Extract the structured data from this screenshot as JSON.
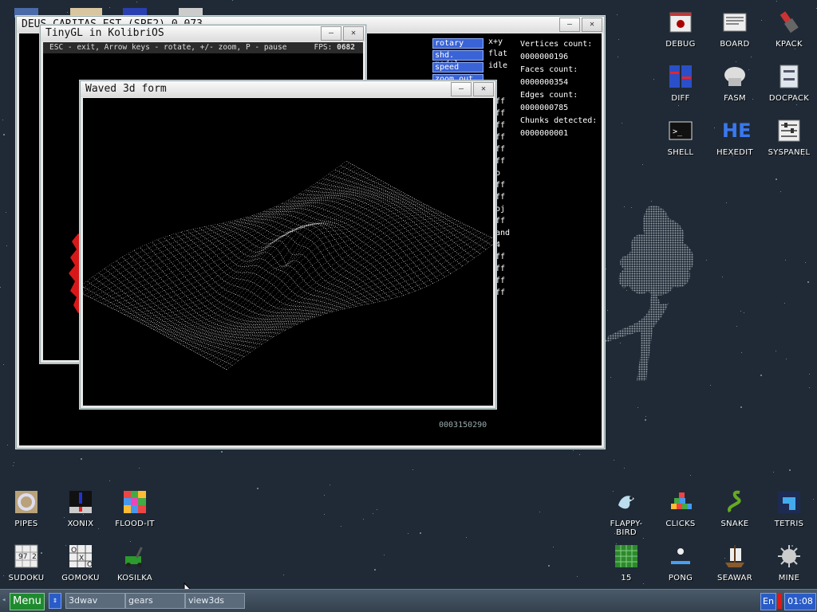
{
  "windows": {
    "deus": {
      "title": "DEUS CARITAS EST (SPF2) 0.073",
      "counter": "0003150290"
    },
    "tinygl": {
      "title": "TinyGL in KolibriOS",
      "hint": "ESC - exit, Arrow keys - rotate, +/- zoom, P - pause",
      "fps_label": "FPS:",
      "fps_value": "0682"
    },
    "waved": {
      "title": "Waved 3d form"
    }
  },
  "view3ds": {
    "controls": [
      {
        "label": "rotary",
        "value": "x+y"
      },
      {
        "label": "shd. model",
        "value": "flat"
      },
      {
        "label": "speed",
        "value": "idle"
      },
      {
        "label": "zoom out",
        "value": ""
      }
    ],
    "stats": {
      "vertices_label": "Vertices count:",
      "vertices": "0000000196",
      "faces_label": "Faces count:",
      "faces": "0000000354",
      "edges_label": "Edges count:",
      "edges": "0000000785",
      "chunks_label": "Chunks detected:",
      "chunks": "0000000001"
    },
    "side_items": [
      "ff",
      "ff",
      "ff",
      "ff",
      "ff",
      "ff",
      "o",
      "ff",
      "ff",
      "oj",
      "ff",
      "and",
      "4",
      "ff",
      "ff",
      "ff",
      "ff"
    ]
  },
  "desktop_icons_right": [
    {
      "label": "DEBUG",
      "icon": "debug-icon"
    },
    {
      "label": "BOARD",
      "icon": "board-icon"
    },
    {
      "label": "KPACK",
      "icon": "kpack-icon"
    },
    {
      "label": "DIFF",
      "icon": "diff-icon"
    },
    {
      "label": "FASM",
      "icon": "fasm-icon"
    },
    {
      "label": "DOCPACK",
      "icon": "docpack-icon"
    },
    {
      "label": "SHELL",
      "icon": "shell-icon"
    },
    {
      "label": "HEXEDIT",
      "icon": "hexedit-icon"
    },
    {
      "label": "SYSPANEL",
      "icon": "syspanel-icon"
    }
  ],
  "desktop_icons_bottom_left": [
    {
      "label": "PIPES",
      "icon": "pipes-icon"
    },
    {
      "label": "XONIX",
      "icon": "xonix-icon"
    },
    {
      "label": "FLOOD-IT",
      "icon": "flood-it-icon"
    },
    {
      "label": "SUDOKU",
      "icon": "sudoku-icon"
    },
    {
      "label": "GOMOKU",
      "icon": "gomoku-icon"
    },
    {
      "label": "KOSILKA",
      "icon": "kosilka-icon"
    }
  ],
  "desktop_icons_bottom_right": [
    {
      "label": "FLAPPY-BIRD",
      "icon": "flappy-bird-icon"
    },
    {
      "label": "CLICKS",
      "icon": "clicks-icon"
    },
    {
      "label": "SNAKE",
      "icon": "snake-icon"
    },
    {
      "label": "TETRIS",
      "icon": "tetris-icon"
    },
    {
      "label": "15",
      "icon": "fifteen-icon"
    },
    {
      "label": "PONG",
      "icon": "pong-icon"
    },
    {
      "label": "SEAWAR",
      "icon": "seawar-icon"
    },
    {
      "label": "MINE",
      "icon": "mine-icon"
    }
  ],
  "hexedit_glyph": "HE",
  "sudoku_digits": "97  2",
  "taskbar": {
    "menu_label": "Menu",
    "tasks": [
      "3dwav",
      "gears",
      "view3ds"
    ],
    "lang": "En",
    "clock": "01:08"
  },
  "colors": {
    "accent": "#1e8a2e",
    "desktop": "#1f2a36",
    "control_bg": "#3a63d8"
  }
}
